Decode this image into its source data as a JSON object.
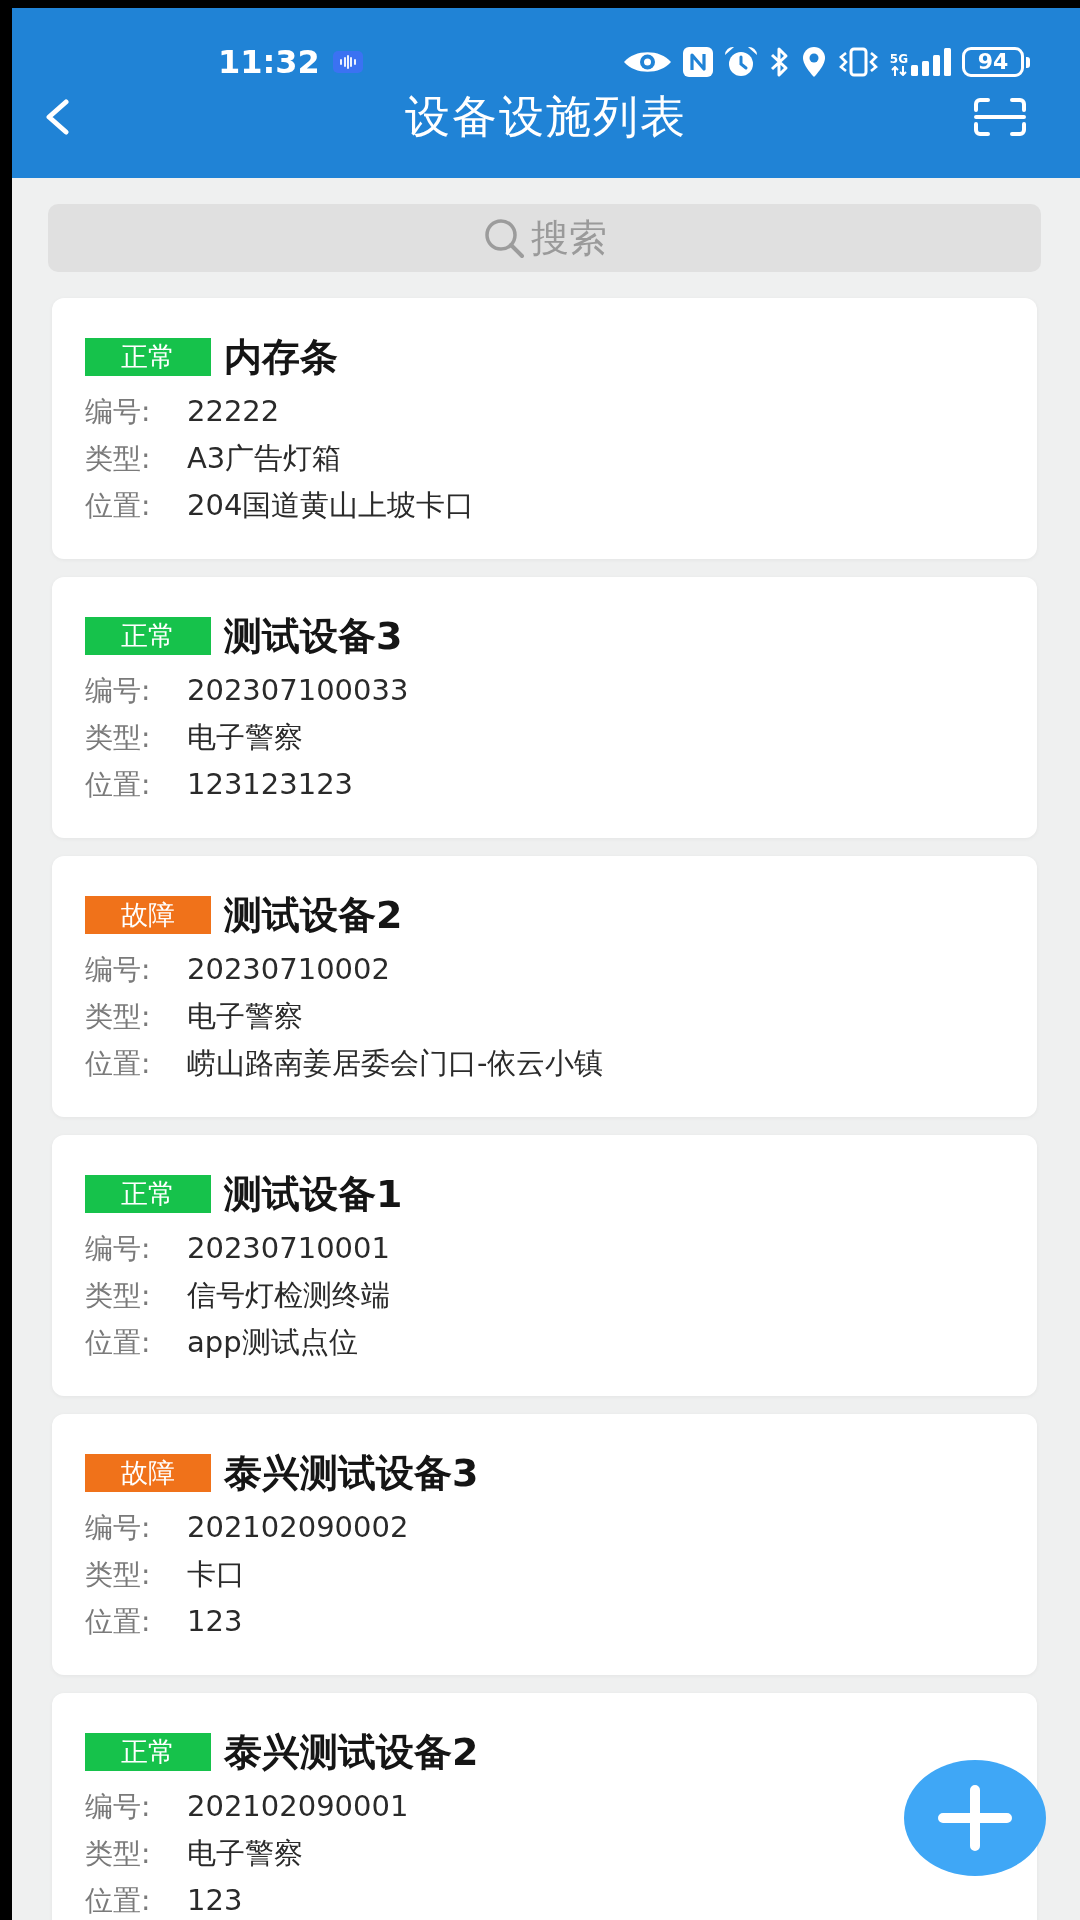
{
  "status_bar": {
    "time": "11:32",
    "network": "5G",
    "battery": "94"
  },
  "header": {
    "title": "设备设施列表"
  },
  "search": {
    "placeholder": "搜索"
  },
  "devices": [
    {
      "status": {
        "label": "正常",
        "color": "#16c24b"
      },
      "name": "内存条",
      "fields": [
        {
          "label": "编号:",
          "value": "22222"
        },
        {
          "label": "类型:",
          "value": "A3广告灯箱"
        },
        {
          "label": "位置:",
          "value": "204国道黄山上坡卡口"
        }
      ]
    },
    {
      "status": {
        "label": "正常",
        "color": "#16c24b"
      },
      "name": "测试设备3",
      "fields": [
        {
          "label": "编号:",
          "value": "202307100033"
        },
        {
          "label": "类型:",
          "value": "电子警察"
        },
        {
          "label": "位置:",
          "value": "123123123"
        }
      ]
    },
    {
      "status": {
        "label": "故障",
        "color": "#f0721a"
      },
      "name": "测试设备2",
      "fields": [
        {
          "label": "编号:",
          "value": "20230710002"
        },
        {
          "label": "类型:",
          "value": "电子警察"
        },
        {
          "label": "位置:",
          "value": "崂山路南姜居委会门口-依云小镇"
        }
      ]
    },
    {
      "status": {
        "label": "正常",
        "color": "#16c24b"
      },
      "name": "测试设备1",
      "fields": [
        {
          "label": "编号:",
          "value": "20230710001"
        },
        {
          "label": "类型:",
          "value": "信号灯检测终端"
        },
        {
          "label": "位置:",
          "value": "app测试点位"
        }
      ]
    },
    {
      "status": {
        "label": "故障",
        "color": "#f0721a"
      },
      "name": "泰兴测试设备3",
      "fields": [
        {
          "label": "编号:",
          "value": "202102090002"
        },
        {
          "label": "类型:",
          "value": "卡口"
        },
        {
          "label": "位置:",
          "value": "123"
        }
      ]
    },
    {
      "status": {
        "label": "正常",
        "color": "#16c24b"
      },
      "name": "泰兴测试设备2",
      "fields": [
        {
          "label": "编号:",
          "value": "202102090001"
        },
        {
          "label": "类型:",
          "value": "电子警察"
        },
        {
          "label": "位置:",
          "value": "123"
        }
      ]
    }
  ]
}
